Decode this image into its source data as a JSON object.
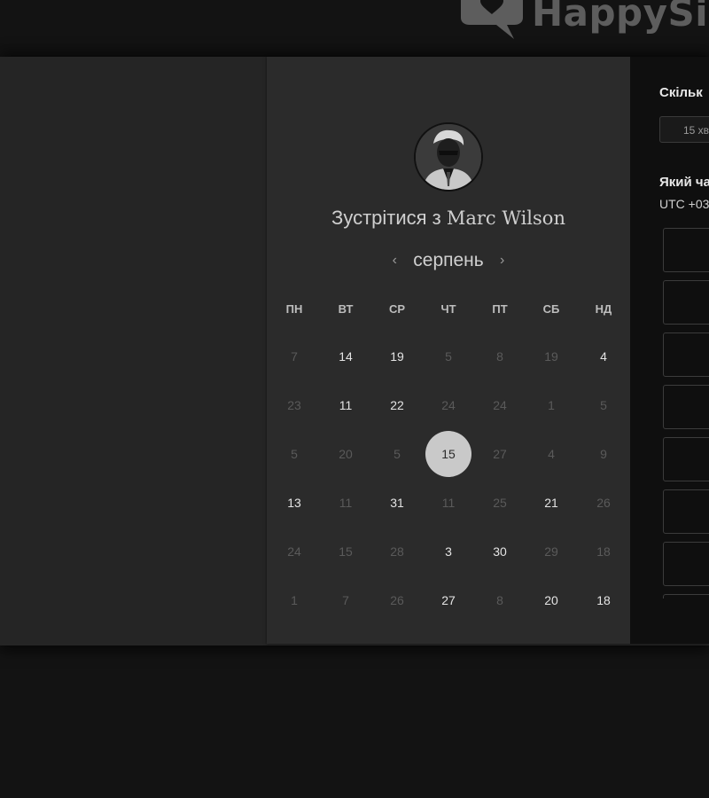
{
  "brand": {
    "name": "HappySig"
  },
  "booking": {
    "meet_prefix": "Зустрітися з",
    "host_name": "Marc Wilson",
    "avatar_icon": "person-portrait-icon"
  },
  "calendar": {
    "month": "серпень",
    "prev_icon": "chevron-left-icon",
    "next_icon": "chevron-right-icon",
    "weekdays": [
      "ПН",
      "ВТ",
      "СР",
      "ЧТ",
      "ПТ",
      "СБ",
      "НД"
    ],
    "weeks": [
      [
        {
          "d": "7",
          "active": false
        },
        {
          "d": "14",
          "active": true
        },
        {
          "d": "19",
          "active": true
        },
        {
          "d": "5",
          "active": false
        },
        {
          "d": "8",
          "active": false
        },
        {
          "d": "19",
          "active": false
        },
        {
          "d": "4",
          "active": true
        }
      ],
      [
        {
          "d": "23",
          "active": false
        },
        {
          "d": "11",
          "active": true
        },
        {
          "d": "22",
          "active": true
        },
        {
          "d": "24",
          "active": false
        },
        {
          "d": "24",
          "active": false
        },
        {
          "d": "1",
          "active": false
        },
        {
          "d": "5",
          "active": false
        }
      ],
      [
        {
          "d": "5",
          "active": false
        },
        {
          "d": "20",
          "active": false
        },
        {
          "d": "5",
          "active": false
        },
        {
          "d": "15",
          "active": true,
          "selected": true
        },
        {
          "d": "27",
          "active": false
        },
        {
          "d": "4",
          "active": false
        },
        {
          "d": "9",
          "active": false
        }
      ],
      [
        {
          "d": "13",
          "active": true
        },
        {
          "d": "11",
          "active": false
        },
        {
          "d": "31",
          "active": true
        },
        {
          "d": "11",
          "active": false
        },
        {
          "d": "25",
          "active": false
        },
        {
          "d": "21",
          "active": true
        },
        {
          "d": "26",
          "active": false
        }
      ],
      [
        {
          "d": "24",
          "active": false
        },
        {
          "d": "15",
          "active": false
        },
        {
          "d": "28",
          "active": false
        },
        {
          "d": "3",
          "active": true
        },
        {
          "d": "30",
          "active": true
        },
        {
          "d": "29",
          "active": false
        },
        {
          "d": "18",
          "active": false
        }
      ],
      [
        {
          "d": "1",
          "active": false
        },
        {
          "d": "7",
          "active": false
        },
        {
          "d": "26",
          "active": false
        },
        {
          "d": "27",
          "active": true
        },
        {
          "d": "8",
          "active": false
        },
        {
          "d": "20",
          "active": true
        },
        {
          "d": "18",
          "active": true
        }
      ]
    ]
  },
  "right_panel": {
    "duration_heading": "Скільк",
    "duration_value": "15 хв",
    "time_heading": "Який ча",
    "timezone": "UTC +03",
    "slots": [
      "",
      "",
      "",
      "",
      "",
      "",
      "",
      ""
    ]
  },
  "colors": {
    "background": "#131313",
    "panel": "#2b2b2b",
    "selected_day": "#c9c9c9",
    "right_panel": "#0f0f0f"
  }
}
